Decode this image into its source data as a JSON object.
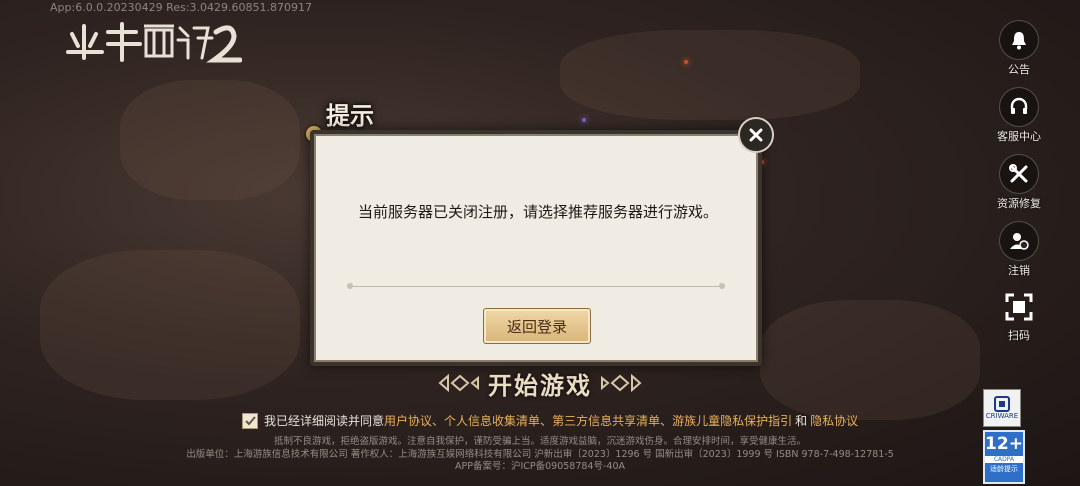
{
  "version_text": "App:6.0.0.20230429  Res:3.0429.60851.870917",
  "logo_text": "少年西游记2",
  "side_menu": [
    {
      "label": "公告",
      "icon": "bell-icon"
    },
    {
      "label": "客服中心",
      "icon": "headset-icon"
    },
    {
      "label": "资源修复",
      "icon": "tools-icon"
    },
    {
      "label": "注销",
      "icon": "user-logout-icon"
    },
    {
      "label": "扫码",
      "icon": "scan-icon"
    }
  ],
  "dialog": {
    "title": "提示",
    "message": "当前服务器已关闭注册，请选择推荐服务器进行游戏。",
    "button": "返回登录"
  },
  "start_game": "开始游戏",
  "agreement": {
    "prefix": "我已经详细阅读并同意",
    "links": [
      "用户协议",
      "个人信息收集清单",
      "第三方信息共享清单",
      "游族儿童隐私保护指引"
    ],
    "and": "和",
    "last_link": "隐私协议",
    "sep": "、",
    "checked": true
  },
  "footer": {
    "line1": "抵制不良游戏，拒绝盗版游戏。注意自我保护，谨防受骗上当。适度游戏益脑，沉迷游戏伤身。合理安排时间，享受健康生活。",
    "line2": "出版单位：上海游族信息技术有限公司 著作权人：上海游族互娱网络科技有限公司 沪新出审〔2023〕1296 号  国新出审〔2023〕1999 号  ISBN 978-7-498-12781-5",
    "line3": "APP备案号：沪ICP备09058784号-40A"
  },
  "badges": {
    "cri": "CRIWARE",
    "age": "12+",
    "age_org": "CADPA",
    "age_note": "适龄提示"
  }
}
